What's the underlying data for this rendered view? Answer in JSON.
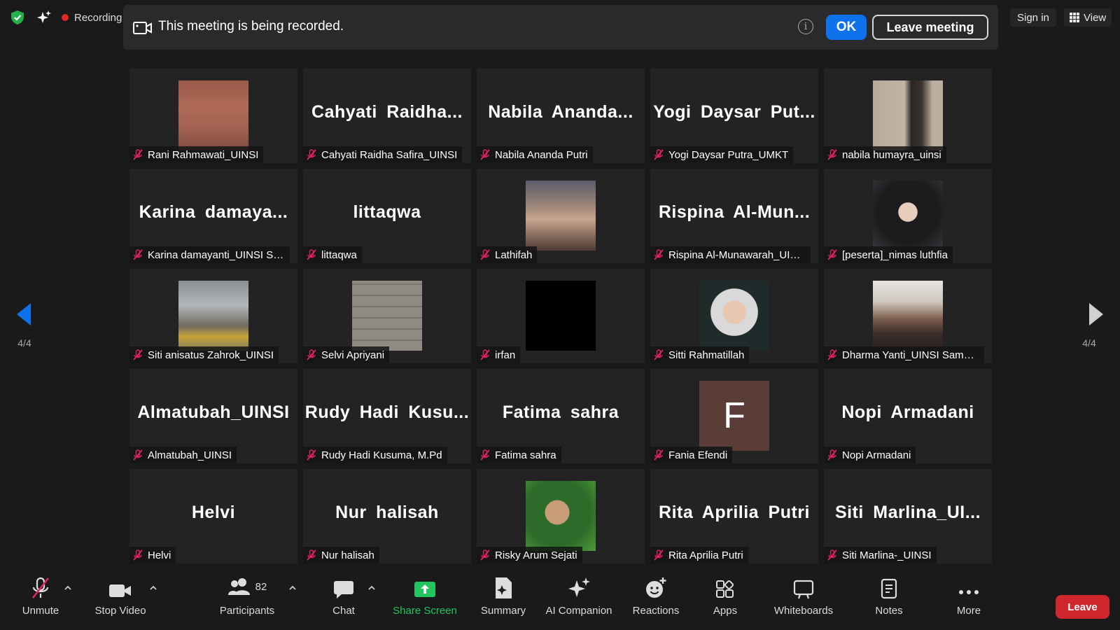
{
  "topbar": {
    "recording_label": "Recording",
    "signin_label": "Sign in",
    "view_label": "View"
  },
  "banner": {
    "message": "This meeting is being recorded.",
    "info_glyph": "i",
    "ok_label": "OK",
    "leave_meeting_label": "Leave meeting"
  },
  "tiles": [
    {
      "display": "photo",
      "name": "Rani Rahmawati_UINSI",
      "photo": "brick-wall"
    },
    {
      "display": "Cahyati Raidha...",
      "name": "Cahyati Raidha Safira_UINSI"
    },
    {
      "display": "Nabila Ananda...",
      "name": "Nabila Ananda Putri"
    },
    {
      "display": "Yogi Daysar Put...",
      "name": "Yogi Daysar Putra_UMKT"
    },
    {
      "display": "photo",
      "name": "nabila humayra_uinsi",
      "photo": "standing-figure"
    },
    {
      "display": "Karina damaya...",
      "name": "Karina damayanti_UINSI Sa..."
    },
    {
      "display": "littaqwa",
      "name": "littaqwa"
    },
    {
      "display": "photo",
      "name": "Lathifah",
      "photo": "sunset-hijab"
    },
    {
      "display": "Rispina Al-Mun...",
      "name": "Rispina Al-Munawarah_UINSI"
    },
    {
      "display": "photo",
      "name": "[peserta]_nimas luthfia",
      "photo": "portrait-hijab"
    },
    {
      "display": "photo",
      "name": "Siti anisatus Zahrok_UINSI",
      "photo": "stairs"
    },
    {
      "display": "photo",
      "name": "Selvi Apriyani",
      "photo": "stone-wall"
    },
    {
      "display": "photo",
      "name": "irfan",
      "photo": "black"
    },
    {
      "display": "photo",
      "name": "Sitti Rahmatillah",
      "photo": "selfie"
    },
    {
      "display": "photo",
      "name": "Dharma Yanti_UINSI Samari...",
      "photo": "group"
    },
    {
      "display": "Almatubah_UINSI",
      "name": "Almatubah_UINSI"
    },
    {
      "display": "Rudy Hadi Kusu...",
      "name": "Rudy Hadi Kusuma, M.Pd"
    },
    {
      "display": "Fatima sahra",
      "name": "Fatima sahra"
    },
    {
      "display": "initial",
      "initial": "F",
      "name": "Fania Efendi"
    },
    {
      "display": "Nopi Armadani",
      "name": "Nopi Armadani"
    },
    {
      "display": "Helvi",
      "name": "Helvi"
    },
    {
      "display": "Nur halisah",
      "name": "Nur halisah"
    },
    {
      "display": "photo",
      "name": "Risky Arum Sejati",
      "photo": "boy-green"
    },
    {
      "display": "Rita Aprilia Putri",
      "name": "Rita Aprilia Putri"
    },
    {
      "display": "Siti Marlina_UI...",
      "name": "Siti Marlina-_UINSI"
    }
  ],
  "pagination": {
    "left_label": "4/4",
    "right_label": "4/4"
  },
  "toolbar": {
    "unmute": "Unmute",
    "stop_video": "Stop Video",
    "participants": "Participants",
    "participant_count": "82",
    "chat": "Chat",
    "share_screen": "Share Screen",
    "summary": "Summary",
    "ai_companion": "AI Companion",
    "reactions": "Reactions",
    "apps": "Apps",
    "whiteboards": "Whiteboards",
    "notes": "Notes",
    "more": "More",
    "leave": "Leave"
  },
  "colors": {
    "background": "#1a1a1a",
    "tile": "#232323",
    "accent_blue": "#0e72ed",
    "share_green": "#22c55e",
    "leave_red": "#d0262e",
    "muted_red": "#e0245e"
  }
}
